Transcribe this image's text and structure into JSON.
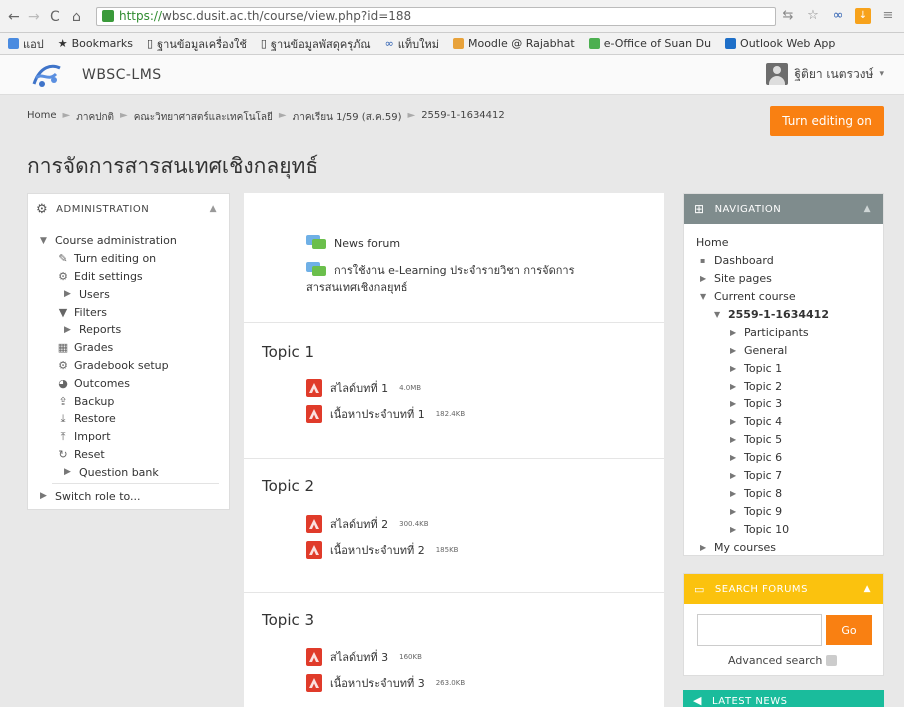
{
  "browser": {
    "url_https": "https://",
    "url_rest": "wbsc.dusit.ac.th/course/view.php?id=188",
    "bookmarks": [
      "แอป",
      "Bookmarks",
      "ฐานข้อมูลเครื่องใช้",
      "ฐานข้อมูลพัสดุครุภัณ",
      "แท็บใหม่",
      "Moodle @ Rajabhat",
      "e-Office of Suan Du",
      "Outlook Web App"
    ]
  },
  "header": {
    "site_name": "WBSC-LMS",
    "user_name": "ฐิติยา เนตรวงษ์"
  },
  "breadcrumb": [
    "Home",
    "ภาคปกติ",
    "คณะวิทยาศาสตร์และเทคโนโลยี",
    "ภาคเรียน 1/59 (ส.ค.59)",
    "2559-1-1634412"
  ],
  "turn_editing_label": "Turn editing on",
  "page_title": "การจัดการสารสนเทศเชิงกลยุทธ์",
  "administration": {
    "title": "ADMINISTRATION",
    "items": [
      "Course administration",
      "Turn editing on",
      "Edit settings",
      "Users",
      "Filters",
      "Reports",
      "Grades",
      "Gradebook setup",
      "Outcomes",
      "Backup",
      "Restore",
      "Import",
      "Reset",
      "Question bank",
      "Switch role to..."
    ]
  },
  "content": {
    "general": {
      "forum": "News forum",
      "elearning_line1": "การใช้งาน e-Learning ประจำรายวิชา การจัดการ",
      "elearning_line2": "สารสนเทศเชิงกลยุทธ์"
    },
    "topics": [
      {
        "title": "Topic 1",
        "items": [
          {
            "name": "สไลด์บทที่ 1",
            "size": "4.0MB"
          },
          {
            "name": "เนื้อหาประจำบทที่ 1",
            "size": "182.4KB"
          }
        ]
      },
      {
        "title": "Topic 2",
        "items": [
          {
            "name": "สไลด์บทที่ 2",
            "size": "300.4KB"
          },
          {
            "name": "เนื้อหาประจำบทที่ 2",
            "size": "185KB"
          }
        ]
      },
      {
        "title": "Topic 3",
        "items": [
          {
            "name": "สไลด์บทที่ 3",
            "size": "160KB"
          },
          {
            "name": "เนื้อหาประจำบทที่ 3",
            "size": "263.0KB"
          }
        ]
      }
    ]
  },
  "navigation": {
    "title": "NAVIGATION",
    "home": "Home",
    "dashboard": "Dashboard",
    "site_pages": "Site pages",
    "current_course": "Current course",
    "course_code": "2559-1-1634412",
    "participants": "Participants",
    "general": "General",
    "topics": [
      "Topic 1",
      "Topic 2",
      "Topic 3",
      "Topic 4",
      "Topic 5",
      "Topic 6",
      "Topic 7",
      "Topic 8",
      "Topic 9",
      "Topic 10"
    ],
    "my_courses": "My courses"
  },
  "search_forums": {
    "title": "SEARCH FORUMS",
    "input_value": "",
    "go_label": "Go",
    "advanced": "Advanced search"
  },
  "latest_news": {
    "title": "LATEST NEWS"
  },
  "colors": {
    "accent_orange": "#f98012",
    "nav_header": "#7f8c8d",
    "search_header": "#fbc20e",
    "news_header": "#1abc9c"
  }
}
